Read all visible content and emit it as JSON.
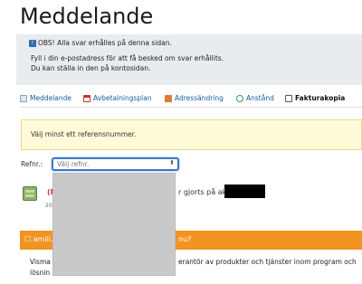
{
  "page": {
    "title": "Meddelande"
  },
  "notice": {
    "line1": "OBS! Alla svar erhålles på denna sidan.",
    "line2": "Fyll i din e-postadress för att få besked om svar erhållits.",
    "line3": "Du kan ställa in den på kontosidan."
  },
  "tabs": [
    {
      "label": "Meddelande",
      "icon": "envelope-icon"
    },
    {
      "label": "Avbetalningsplan",
      "icon": "calendar-icon"
    },
    {
      "label": "Adressändring",
      "icon": "house-icon"
    },
    {
      "label": "Anstånd",
      "icon": "clock-icon"
    },
    {
      "label": "Fakturakopia",
      "icon": "document-icon"
    }
  ],
  "alert": {
    "text": "Välj minst ett referensnummer."
  },
  "reference": {
    "label": "Refnr.:",
    "placeholder": "Välj refnr.",
    "caret": "⬍"
  },
  "message_row": {
    "title_prefix": "(N",
    "title_suffix": "r gjorts på akt",
    "date_prefix": "20"
  },
  "banner": {
    "left": "amili.",
    "right": "nu?"
  },
  "footer": {
    "line1_left": "Visma",
    "line1_right": "erantör av produkter och tjänster inom program och",
    "line2_left": "lösnin"
  },
  "colors": {
    "accent": "#f39322",
    "link": "#1a5aa0",
    "focus": "#3a78c7",
    "alert_bg": "#fffbd9"
  }
}
